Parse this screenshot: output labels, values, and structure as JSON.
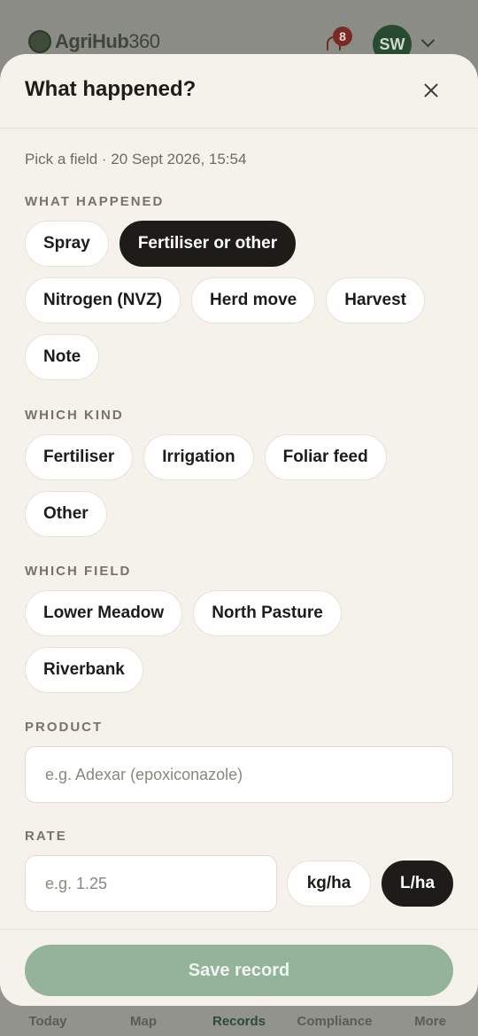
{
  "app": {
    "logo_text": "AgriHub",
    "logo_suffix": "360",
    "notification_count": "8",
    "avatar_initials": "SW"
  },
  "bottom_nav": [
    {
      "label": "Today",
      "active": false
    },
    {
      "label": "Map",
      "active": false
    },
    {
      "label": "Records",
      "active": true
    },
    {
      "label": "Compliance",
      "active": false
    },
    {
      "label": "More",
      "active": false
    }
  ],
  "sheet": {
    "title": "What happened?",
    "context": "Pick a field · 20 Sept 2026, 15:54",
    "what_happened": {
      "label": "WHAT HAPPENED",
      "options": [
        "Spray",
        "Fertiliser or other",
        "Nitrogen (NVZ)",
        "Herd move",
        "Harvest",
        "Note"
      ],
      "selected": "Fertiliser or other"
    },
    "which_kind": {
      "label": "WHICH KIND",
      "options": [
        "Fertiliser",
        "Irrigation",
        "Foliar feed",
        "Other"
      ],
      "selected": ""
    },
    "which_field": {
      "label": "WHICH FIELD",
      "options": [
        "Lower Meadow",
        "North Pasture",
        "Riverbank"
      ],
      "selected": ""
    },
    "product": {
      "label": "PRODUCT",
      "placeholder": "e.g. Adexar (epoxiconazole)",
      "value": ""
    },
    "rate": {
      "label": "RATE",
      "placeholder": "e.g. 1.25",
      "value": "",
      "units": [
        "kg/ha",
        "L/ha"
      ],
      "selected_unit": "L/ha"
    },
    "save_label": "Save record"
  },
  "colors": {
    "selected_chip": "#1d1c18",
    "sheet_bg": "#f5f2eb",
    "save_button": "#93b39b",
    "section_label": "#7a7266"
  }
}
